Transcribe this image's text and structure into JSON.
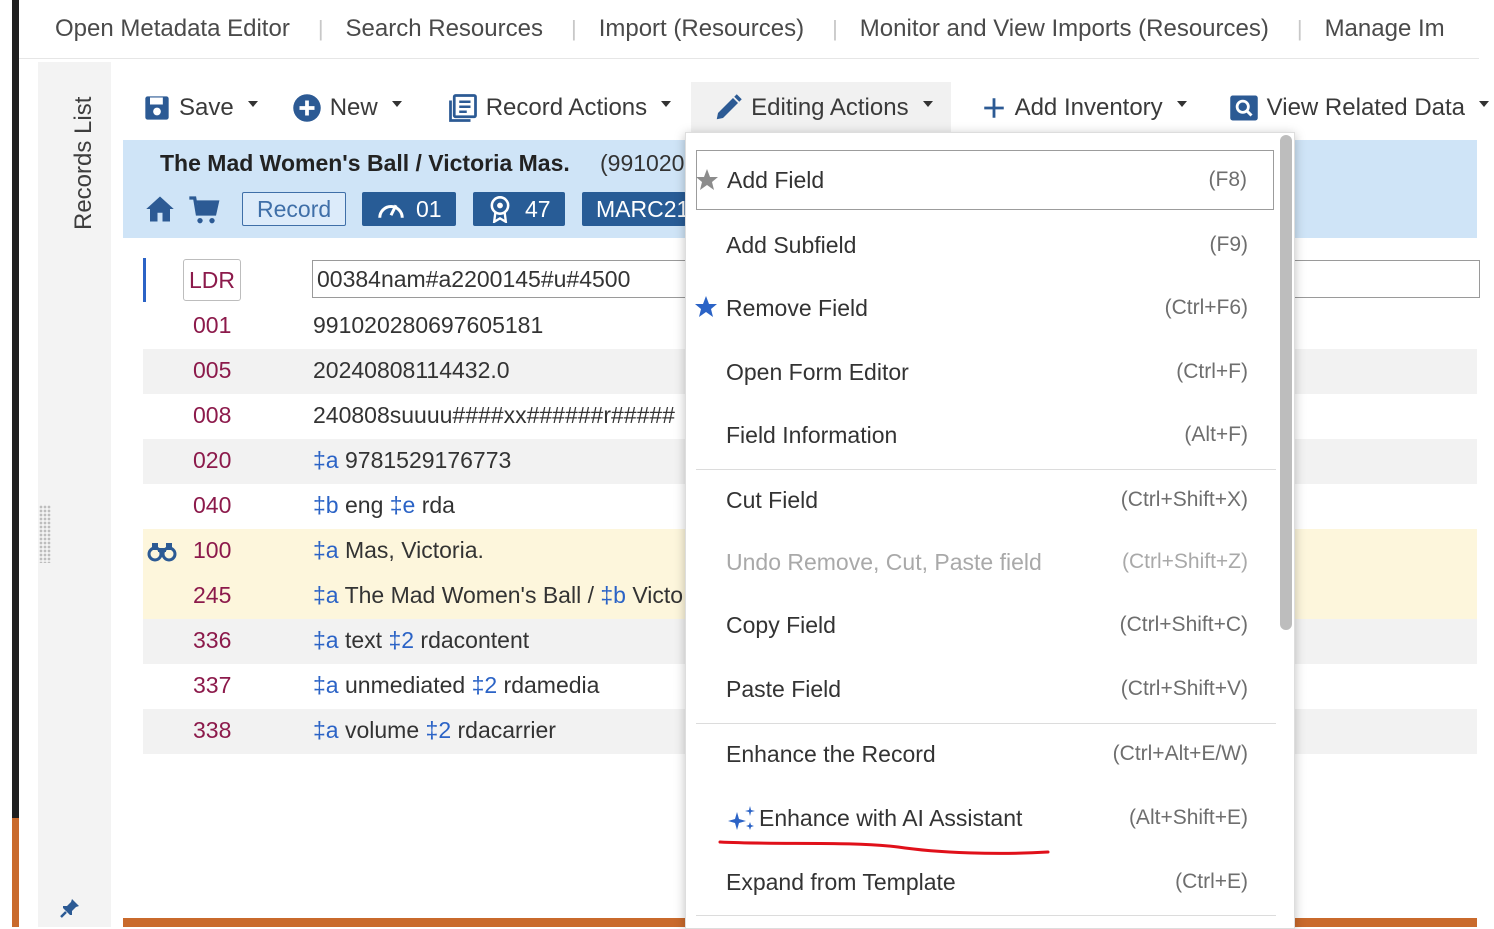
{
  "top_tabs": [
    "Open Metadata Editor",
    "Search Resources",
    "Import (Resources)",
    "Monitor and View Imports (Resources)",
    "Manage Im"
  ],
  "sidebar": {
    "label": "Records List"
  },
  "toolbar": {
    "save": "Save",
    "new": "New",
    "record_actions": "Record Actions",
    "editing_actions": "Editing Actions",
    "add_inventory": "Add Inventory",
    "view_related": "View Related Data"
  },
  "record": {
    "title": "The Mad Women's Ball / Victoria Mas.",
    "id": "(991020",
    "badges": {
      "record": "Record",
      "speed": "01",
      "award": "47",
      "format": "MARC21"
    }
  },
  "fields": {
    "ldr": {
      "tag": "LDR",
      "value": "00384nam#a2200145#u#4500"
    },
    "rows": [
      {
        "tag": "001",
        "value": "991020280697605181"
      },
      {
        "tag": "005",
        "value": "20240808114432.0"
      },
      {
        "tag": "008",
        "value": "240808suuuu####xx######r#####"
      },
      {
        "tag": "020",
        "sf1": "‡a",
        "t1": " 9781529176773"
      },
      {
        "tag": "040",
        "sf1": "‡b",
        "t1": " eng ",
        "sf2": "‡e",
        "t2": " rda"
      },
      {
        "tag": "100",
        "sf1": "‡a",
        "t1": " Mas, Victoria."
      },
      {
        "tag": "245",
        "sf1": "‡a",
        "t1": " The Mad Women's Ball / ",
        "sf2": "‡b",
        "t2": " Victo"
      },
      {
        "tag": "336",
        "sf1": "‡a",
        "t1": " text ",
        "sf2": "‡2",
        "t2": " rdacontent"
      },
      {
        "tag": "337",
        "sf1": "‡a",
        "t1": " unmediated ",
        "sf2": "‡2",
        "t2": " rdamedia"
      },
      {
        "tag": "338",
        "sf1": "‡a",
        "t1": " volume ",
        "sf2": "‡2",
        "t2": " rdacarrier"
      }
    ]
  },
  "menu": {
    "items": [
      {
        "label": "Add Field",
        "shortcut": "(F8)"
      },
      {
        "label": "Add Subfield",
        "shortcut": "(F9)"
      },
      {
        "label": "Remove Field",
        "shortcut": "(Ctrl+F6)"
      },
      {
        "label": "Open Form Editor",
        "shortcut": "(Ctrl+F)"
      },
      {
        "label": "Field Information",
        "shortcut": "(Alt+F)"
      },
      {
        "label": "Cut Field",
        "shortcut": "(Ctrl+Shift+X)"
      },
      {
        "label": "Undo Remove, Cut, Paste field",
        "shortcut": "(Ctrl+Shift+Z)"
      },
      {
        "label": "Copy Field",
        "shortcut": "(Ctrl+Shift+C)"
      },
      {
        "label": "Paste Field",
        "shortcut": "(Ctrl+Shift+V)"
      },
      {
        "label": "Enhance the Record",
        "shortcut": "(Ctrl+Alt+E/W)"
      },
      {
        "label": "Enhance with AI Assistant",
        "shortcut": "(Alt+Shift+E)"
      },
      {
        "label": "Expand from Template",
        "shortcut": "(Ctrl+E)"
      }
    ]
  },
  "colors": {
    "accent": "#2b63c6",
    "tag": "#8c1a4b",
    "header_bg": "#cfe4f7",
    "highlight_row": "#fdf6dc",
    "annotation": "#e0101a"
  }
}
